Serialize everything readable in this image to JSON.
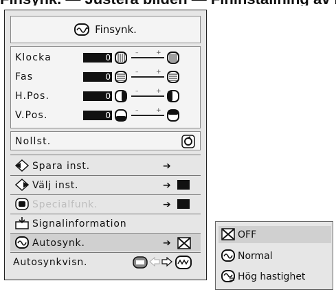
{
  "header": {
    "cut_title": "Finsynk. — Justera bilden — Fininställning av bildsignal"
  },
  "menu": {
    "title": "Finsynk.",
    "adjust": [
      {
        "label": "Klocka",
        "value": "0"
      },
      {
        "label": "Fas",
        "value": "0"
      },
      {
        "label": "H.Pos.",
        "value": "0"
      },
      {
        "label": "V.Pos.",
        "value": "0"
      }
    ],
    "tick_minus": "–",
    "tick_plus": "+",
    "reset_label": "Nollst.",
    "items": [
      {
        "label": "Spara inst.",
        "arrow": "➔",
        "has_box": false,
        "dim": false
      },
      {
        "label": "Välj inst.",
        "arrow": "➔",
        "has_box": true,
        "dim": false
      },
      {
        "label": "Specialfunk.",
        "arrow": "➔",
        "has_box": true,
        "dim": true
      },
      {
        "label": "Signalinformation",
        "arrow": "",
        "has_box": false,
        "dim": false
      },
      {
        "label": "Autosynk.",
        "arrow": "➔",
        "has_box": false,
        "dim": false
      }
    ],
    "autosync_display_label": "Autosynkvisn."
  },
  "submenu": {
    "items": [
      {
        "label": "OFF"
      },
      {
        "label": "Normal"
      },
      {
        "label": "Hög hastighet"
      }
    ]
  }
}
